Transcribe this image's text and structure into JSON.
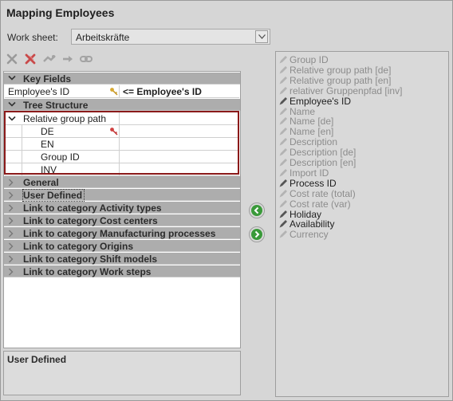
{
  "window": {
    "title": "Mapping Employees"
  },
  "worksheet": {
    "label": "Work sheet:",
    "value": "Arbeitskräfte"
  },
  "toolbar": {
    "icons": [
      "delete-icon",
      "delete-all-icon",
      "link-icon",
      "arrow-right-icon",
      "chain-icon"
    ]
  },
  "tree": {
    "key_fields": {
      "header": "Key Fields",
      "rows": [
        {
          "label": "Employee's ID",
          "value": "<= Employee's ID"
        }
      ]
    },
    "tree_structure": {
      "header": "Tree Structure",
      "parent": "Relative group path",
      "children": [
        "DE",
        "EN",
        "Group ID",
        "INV"
      ]
    },
    "groups": [
      "General",
      "User Defined",
      "Link to category Activity types",
      "Link to category Cost centers",
      "Link to category Manufacturing processes",
      "Link to category Origins",
      "Link to category Shift models",
      "Link to category Work steps"
    ]
  },
  "description": {
    "title": "User Defined"
  },
  "fields": [
    {
      "label": "Group ID",
      "active": false
    },
    {
      "label": "Relative group path [de]",
      "active": false
    },
    {
      "label": "Relative group path [en]",
      "active": false
    },
    {
      "label": "relativer Gruppenpfad [inv]",
      "active": false
    },
    {
      "label": "Employee's ID",
      "active": true
    },
    {
      "label": "Name",
      "active": false
    },
    {
      "label": "Name [de]",
      "active": false
    },
    {
      "label": "Name [en]",
      "active": false
    },
    {
      "label": "Description",
      "active": false
    },
    {
      "label": "Description [de]",
      "active": false
    },
    {
      "label": "Description [en]",
      "active": false
    },
    {
      "label": "Import ID",
      "active": false
    },
    {
      "label": "Process ID",
      "active": true
    },
    {
      "label": "Cost rate (total)",
      "active": false
    },
    {
      "label": "Cost rate (var)",
      "active": false
    },
    {
      "label": "Holiday",
      "active": true
    },
    {
      "label": "Availability",
      "active": true
    },
    {
      "label": "Currency",
      "active": false
    }
  ],
  "colors": {
    "accent": "#8b1a1a",
    "green": "#3a9a3a",
    "group_bar": "#adadad"
  }
}
